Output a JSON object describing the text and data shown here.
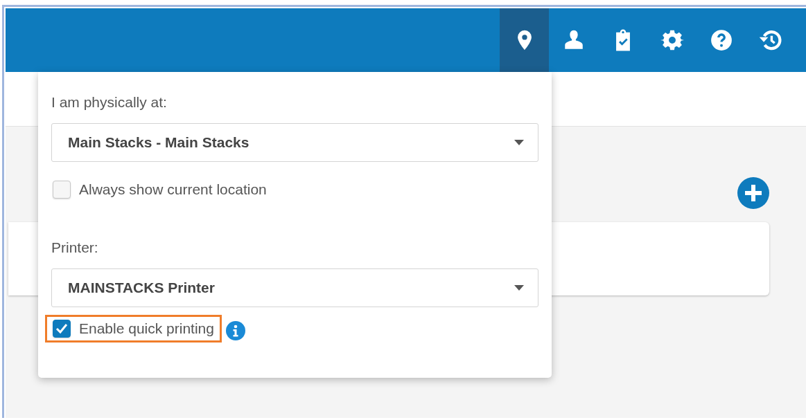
{
  "header": {
    "icons": [
      {
        "kind": "location",
        "selected": true
      },
      {
        "kind": "user",
        "selected": false
      },
      {
        "kind": "tasks",
        "selected": false
      },
      {
        "kind": "settings",
        "selected": false
      },
      {
        "kind": "help",
        "selected": false
      },
      {
        "kind": "history",
        "selected": false
      }
    ]
  },
  "location_menu": {
    "location_label": "I am physically at:",
    "location_select": {
      "value": "Main Stacks - Main Stacks"
    },
    "always_show": {
      "label": "Always show current location",
      "checked": false
    },
    "printer_label": "Printer:",
    "printer_select": {
      "value": "MAINSTACKS Printer"
    },
    "quick_printing": {
      "label": "Enable quick printing",
      "checked": true,
      "highlighted": true
    }
  }
}
